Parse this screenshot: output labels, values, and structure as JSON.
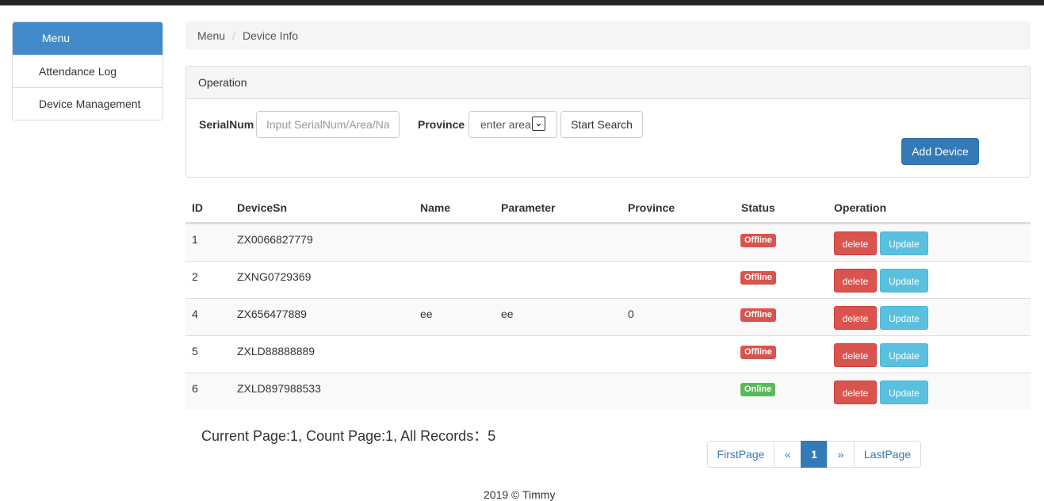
{
  "sidebar": {
    "header": "Menu",
    "items": [
      {
        "label": "Attendance Log"
      },
      {
        "label": "Device Management"
      }
    ]
  },
  "breadcrumb": {
    "root": "Menu",
    "separator": "/",
    "current": "Device Info"
  },
  "panel": {
    "title": "Operation",
    "serial_label": "SerialNum",
    "serial_placeholder": "Input SerialNum/Area/Name",
    "province_label": "Province",
    "province_selected": "enter area",
    "search_button": "Start Search",
    "add_button": "Add Device"
  },
  "table": {
    "headers": [
      "ID",
      "DeviceSn",
      "Name",
      "Parameter",
      "Province",
      "Status",
      "Operation"
    ],
    "rows": [
      {
        "id": "1",
        "sn": "ZX0066827779",
        "name": "",
        "param": "",
        "province": "",
        "status": "Offline",
        "delete": "delete",
        "update": "Update"
      },
      {
        "id": "2",
        "sn": "ZXNG0729369",
        "name": "",
        "param": "",
        "province": "",
        "status": "Offline",
        "delete": "delete",
        "update": "Update"
      },
      {
        "id": "4",
        "sn": "ZX656477889",
        "name": "ee",
        "param": "ee",
        "province": "0",
        "status": "Offline",
        "delete": "delete",
        "update": "Update"
      },
      {
        "id": "5",
        "sn": "ZXLD88888889",
        "name": "",
        "param": "",
        "province": "",
        "status": "Offline",
        "delete": "delete",
        "update": "Update"
      },
      {
        "id": "6",
        "sn": "ZXLD897988533",
        "name": "",
        "param": "",
        "province": "",
        "status": "Online",
        "delete": "delete",
        "update": "Update"
      }
    ]
  },
  "summary": "Current Page:1, Count Page:1, All Records：5",
  "pagination": {
    "first": "FirstPage",
    "prev": "«",
    "current": "1",
    "next": "»",
    "last": "LastPage"
  },
  "footer": {
    "copyright": "2019 © Timmy"
  },
  "colors": {
    "primary": "#337ab7",
    "danger": "#d9534f",
    "info": "#5bc0de",
    "success": "#5cb85c"
  }
}
